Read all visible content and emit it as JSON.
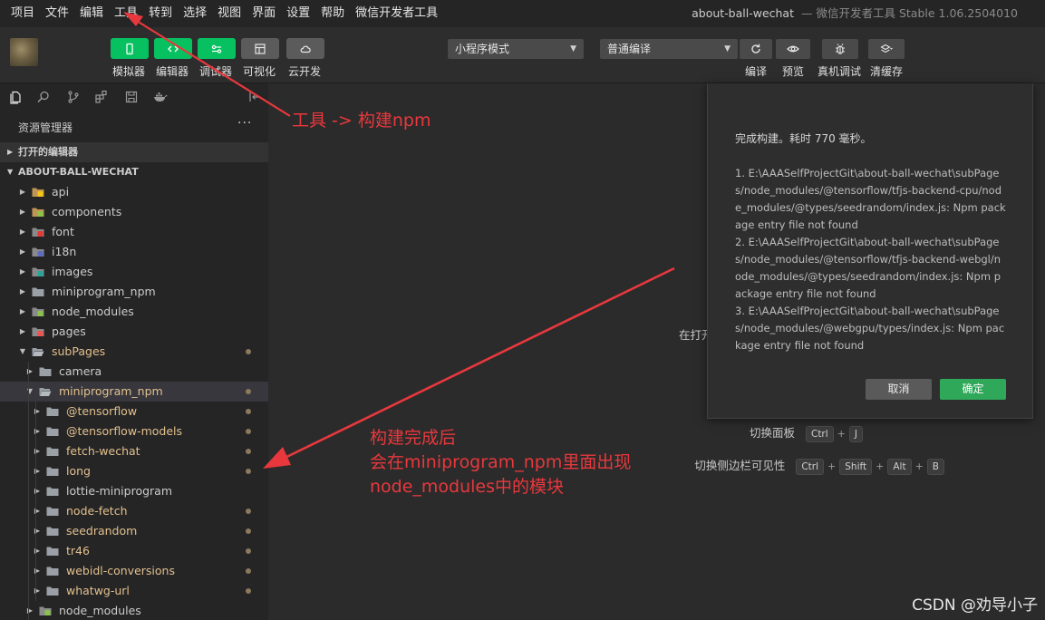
{
  "menubar": {
    "items": [
      "项目",
      "文件",
      "编辑",
      "工具",
      "转到",
      "选择",
      "视图",
      "界面",
      "设置",
      "帮助",
      "微信开发者工具"
    ],
    "project_name": "about-ball-wechat",
    "app_title": "— 微信开发者工具 Stable 1.06.2504010"
  },
  "toolbar": {
    "left_buttons": [
      {
        "label": "模拟器",
        "icon": "phone-icon",
        "color": "#07c160"
      },
      {
        "label": "编辑器",
        "icon": "code-icon",
        "color": "#07c160"
      },
      {
        "label": "调试器",
        "icon": "debug-toggle-icon",
        "color": "#07c160"
      },
      {
        "label": "可视化",
        "icon": "layout-icon",
        "color": "#5b5b5b"
      },
      {
        "label": "云开发",
        "icon": "cloud-icon",
        "color": "#5b5b5b"
      }
    ],
    "mode_select": "小程序模式",
    "compile_select": "普通编译",
    "right_buttons": [
      {
        "label": "编译",
        "icon": "refresh-icon"
      },
      {
        "label": "预览",
        "icon": "eye-icon"
      },
      {
        "label": "真机调试",
        "icon": "bug-icon"
      },
      {
        "label": "清缓存",
        "icon": "layers-icon"
      }
    ]
  },
  "sidebar": {
    "title": "资源管理器",
    "more": "···",
    "open_editors": "打开的编辑器",
    "project_root": "ABOUT-BALL-WECHAT",
    "tree": [
      {
        "label": "api",
        "depth": 1,
        "open": false,
        "icon": "api-folder-icon",
        "modified": false
      },
      {
        "label": "components",
        "depth": 1,
        "open": false,
        "icon": "components-folder-icon",
        "modified": false
      },
      {
        "label": "font",
        "depth": 1,
        "open": false,
        "icon": "font-folder-icon",
        "modified": false
      },
      {
        "label": "i18n",
        "depth": 1,
        "open": false,
        "icon": "i18n-folder-icon",
        "modified": false
      },
      {
        "label": "images",
        "depth": 1,
        "open": false,
        "icon": "images-folder-icon",
        "modified": false
      },
      {
        "label": "miniprogram_npm",
        "depth": 1,
        "open": false,
        "icon": "folder-icon",
        "modified": false
      },
      {
        "label": "node_modules",
        "depth": 1,
        "open": false,
        "icon": "node-folder-icon",
        "modified": false
      },
      {
        "label": "pages",
        "depth": 1,
        "open": false,
        "icon": "pages-folder-icon",
        "modified": false
      },
      {
        "label": "subPages",
        "depth": 1,
        "open": true,
        "icon": "folder-open-icon",
        "modified": true
      },
      {
        "label": "camera",
        "depth": 2,
        "open": false,
        "icon": "folder-icon",
        "modified": false
      },
      {
        "label": "miniprogram_npm",
        "depth": 2,
        "open": true,
        "icon": "folder-open-icon",
        "modified": true
      },
      {
        "label": "@tensorflow",
        "depth": 3,
        "open": false,
        "icon": "folder-icon",
        "modified": true
      },
      {
        "label": "@tensorflow-models",
        "depth": 3,
        "open": false,
        "icon": "folder-icon",
        "modified": true
      },
      {
        "label": "fetch-wechat",
        "depth": 3,
        "open": false,
        "icon": "folder-icon",
        "modified": true
      },
      {
        "label": "long",
        "depth": 3,
        "open": false,
        "icon": "folder-icon",
        "modified": true
      },
      {
        "label": "lottie-miniprogram",
        "depth": 3,
        "open": false,
        "icon": "folder-icon",
        "modified": false
      },
      {
        "label": "node-fetch",
        "depth": 3,
        "open": false,
        "icon": "folder-icon",
        "modified": true
      },
      {
        "label": "seedrandom",
        "depth": 3,
        "open": false,
        "icon": "folder-icon",
        "modified": true
      },
      {
        "label": "tr46",
        "depth": 3,
        "open": false,
        "icon": "folder-icon",
        "modified": true
      },
      {
        "label": "webidl-conversions",
        "depth": 3,
        "open": false,
        "icon": "folder-icon",
        "modified": true
      },
      {
        "label": "whatwg-url",
        "depth": 3,
        "open": false,
        "icon": "folder-icon",
        "modified": true
      },
      {
        "label": "node_modules",
        "depth": 2,
        "open": false,
        "icon": "node-folder-icon",
        "modified": false
      }
    ]
  },
  "editor": {
    "partial_text": "在打开",
    "shortcuts": [
      {
        "label": "切换面板",
        "keys": [
          "Ctrl",
          "J"
        ]
      },
      {
        "label": "切换侧边栏可见性",
        "keys": [
          "Ctrl",
          "Shift",
          "Alt",
          "B"
        ]
      }
    ]
  },
  "dialog": {
    "title": "完成构建。耗时 770 毫秒。",
    "messages": [
      "1. E:\\AAASelfProjectGit\\about-ball-wechat\\subPages/node_modules/@tensorflow/tfjs-backend-cpu/node_modules/@types/seedrandom/index.js: Npm package entry file not found",
      "2. E:\\AAASelfProjectGit\\about-ball-wechat\\subPages/node_modules/@tensorflow/tfjs-backend-webgl/node_modules/@types/seedrandom/index.js: Npm package entry file not found",
      "3. E:\\AAASelfProjectGit\\about-ball-wechat\\subPages/node_modules/@webgpu/types/index.js: Npm package entry file not found"
    ],
    "cancel_label": "取消",
    "ok_label": "确定"
  },
  "annotations": {
    "top": "工具 -> 构建npm",
    "bottom_lines": [
      "构建完成后",
      "会在miniprogram_npm里面出现",
      "node_modules中的模块"
    ],
    "color": "#e8383d"
  },
  "watermark": "CSDN @劝导小子"
}
